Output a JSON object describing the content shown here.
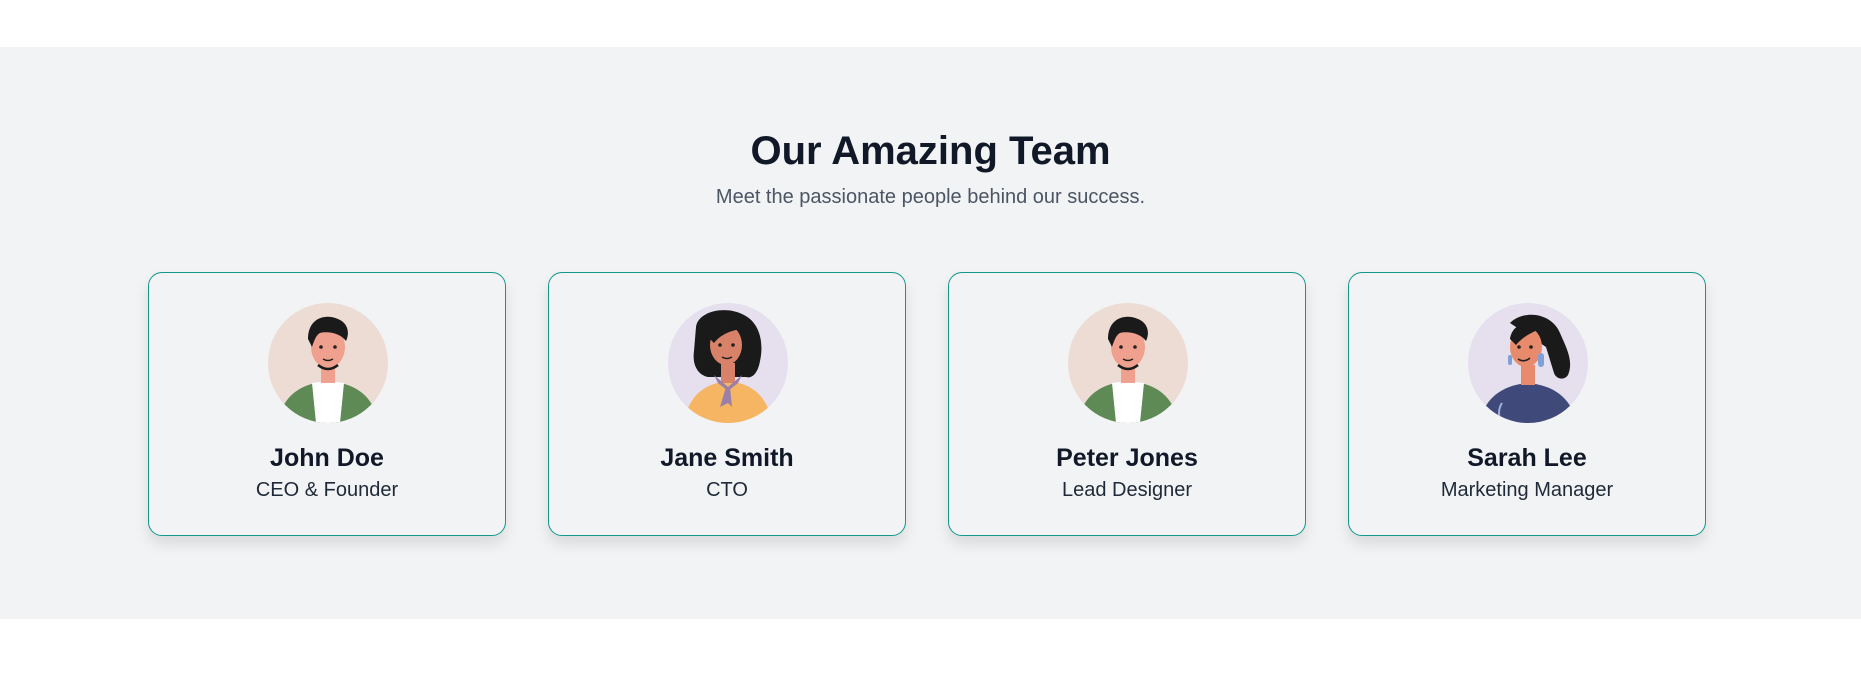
{
  "section": {
    "title": "Our Amazing Team",
    "subtitle": "Meet the passionate people behind our success."
  },
  "team": [
    {
      "name": "John Doe",
      "role": "CEO & Founder",
      "avatar_icon": "man-green-jacket-icon"
    },
    {
      "name": "Jane Smith",
      "role": "CTO",
      "avatar_icon": "woman-yellow-top-scarf-icon"
    },
    {
      "name": "Peter Jones",
      "role": "Lead Designer",
      "avatar_icon": "man-green-jacket-icon"
    },
    {
      "name": "Sarah Lee",
      "role": "Marketing Manager",
      "avatar_icon": "woman-blue-top-earring-icon"
    }
  ],
  "colors": {
    "section_background": "#f2f3f5",
    "card_border": "#14988a",
    "heading": "#111827",
    "subtitle": "#4b5563"
  }
}
